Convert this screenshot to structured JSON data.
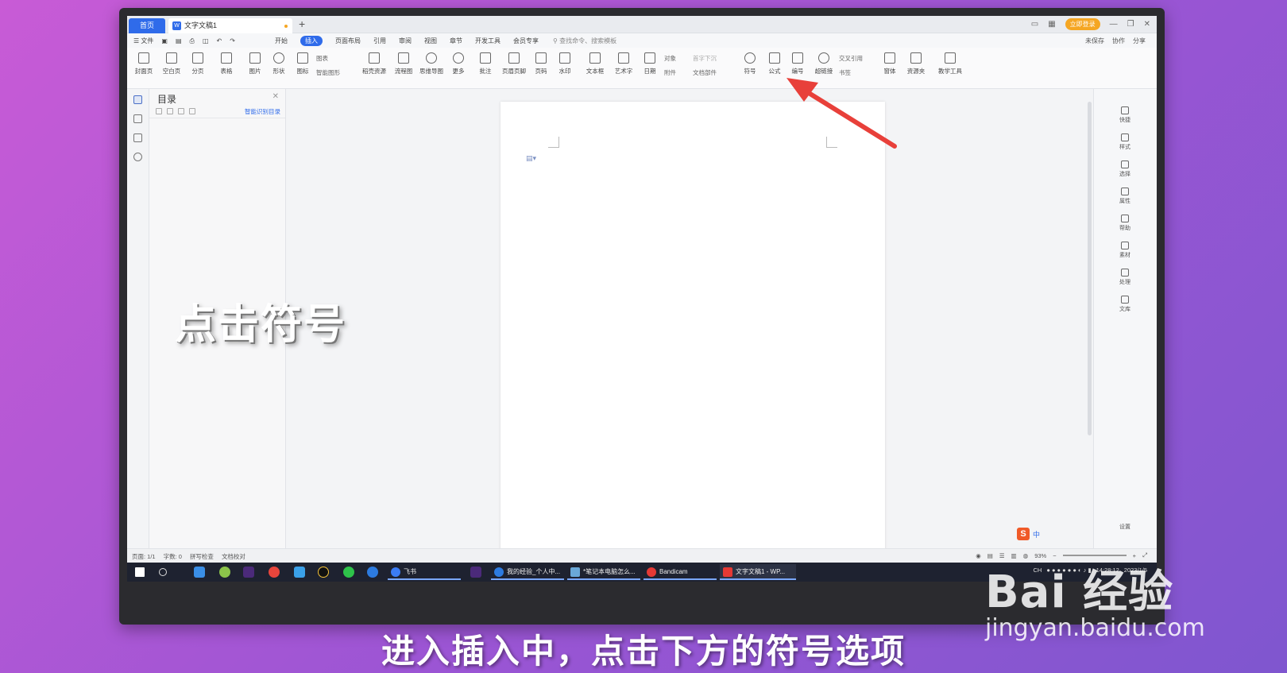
{
  "tabs": {
    "home": "首页",
    "doc": "文字文稿1",
    "add": "+"
  },
  "window": {
    "login": "立即登录"
  },
  "menu": {
    "file": "文件",
    "tabs": [
      "开始",
      "插入",
      "页面布局",
      "引用",
      "审阅",
      "视图",
      "章节",
      "开发工具",
      "会员专享"
    ],
    "active_tab": "插入",
    "search": "查找命令、搜索模板",
    "right": [
      "未保存",
      "协作",
      "分享"
    ]
  },
  "ribbon": {
    "buttons": [
      "封面页",
      "空白页",
      "分页",
      "表格",
      "图片",
      "形状",
      "图标",
      "稻壳资源",
      "流程图",
      "思维导图",
      "更多",
      "批注",
      "页眉页脚",
      "页码",
      "水印",
      "文本框",
      "艺术字",
      "日期",
      "符号",
      "公式",
      "编号",
      "超链接",
      "窗体",
      "资源夹",
      "教学工具"
    ],
    "small": [
      "图表",
      "智能图形",
      "对象",
      "附件",
      "首字下沉",
      "文档部件",
      "交叉引用",
      "书签"
    ]
  },
  "toc": {
    "title": "目录",
    "smart": "智能识别目录"
  },
  "right_panel": [
    "快捷",
    "样式",
    "选择",
    "属性",
    "帮助",
    "素材",
    "处理",
    "文库",
    "设置"
  ],
  "status": {
    "page": "页面: 1/1",
    "words": "字数: 0",
    "spell": "拼写检查",
    "proof": "文档校对",
    "zoom": "93%"
  },
  "ime": {
    "label": "中"
  },
  "taskbar": {
    "items": [
      "飞书",
      "我的经验_个人中...",
      "*笔记本电脑怎么...",
      "Bandicam",
      "文字文稿1 - WP..."
    ],
    "time": "14:28:12",
    "date": "2023/1/5",
    "ch": "CH"
  },
  "overlay": {
    "left_caption": "点击符号",
    "subtitle": "进入插入中，点击下方的符号选项",
    "watermark_logo": "Bai 经验",
    "watermark_url": "jingyan.baidu.com"
  },
  "colors": {
    "accent": "#2f6bea",
    "arrow": "#e8403a",
    "login": "#f5a623"
  }
}
